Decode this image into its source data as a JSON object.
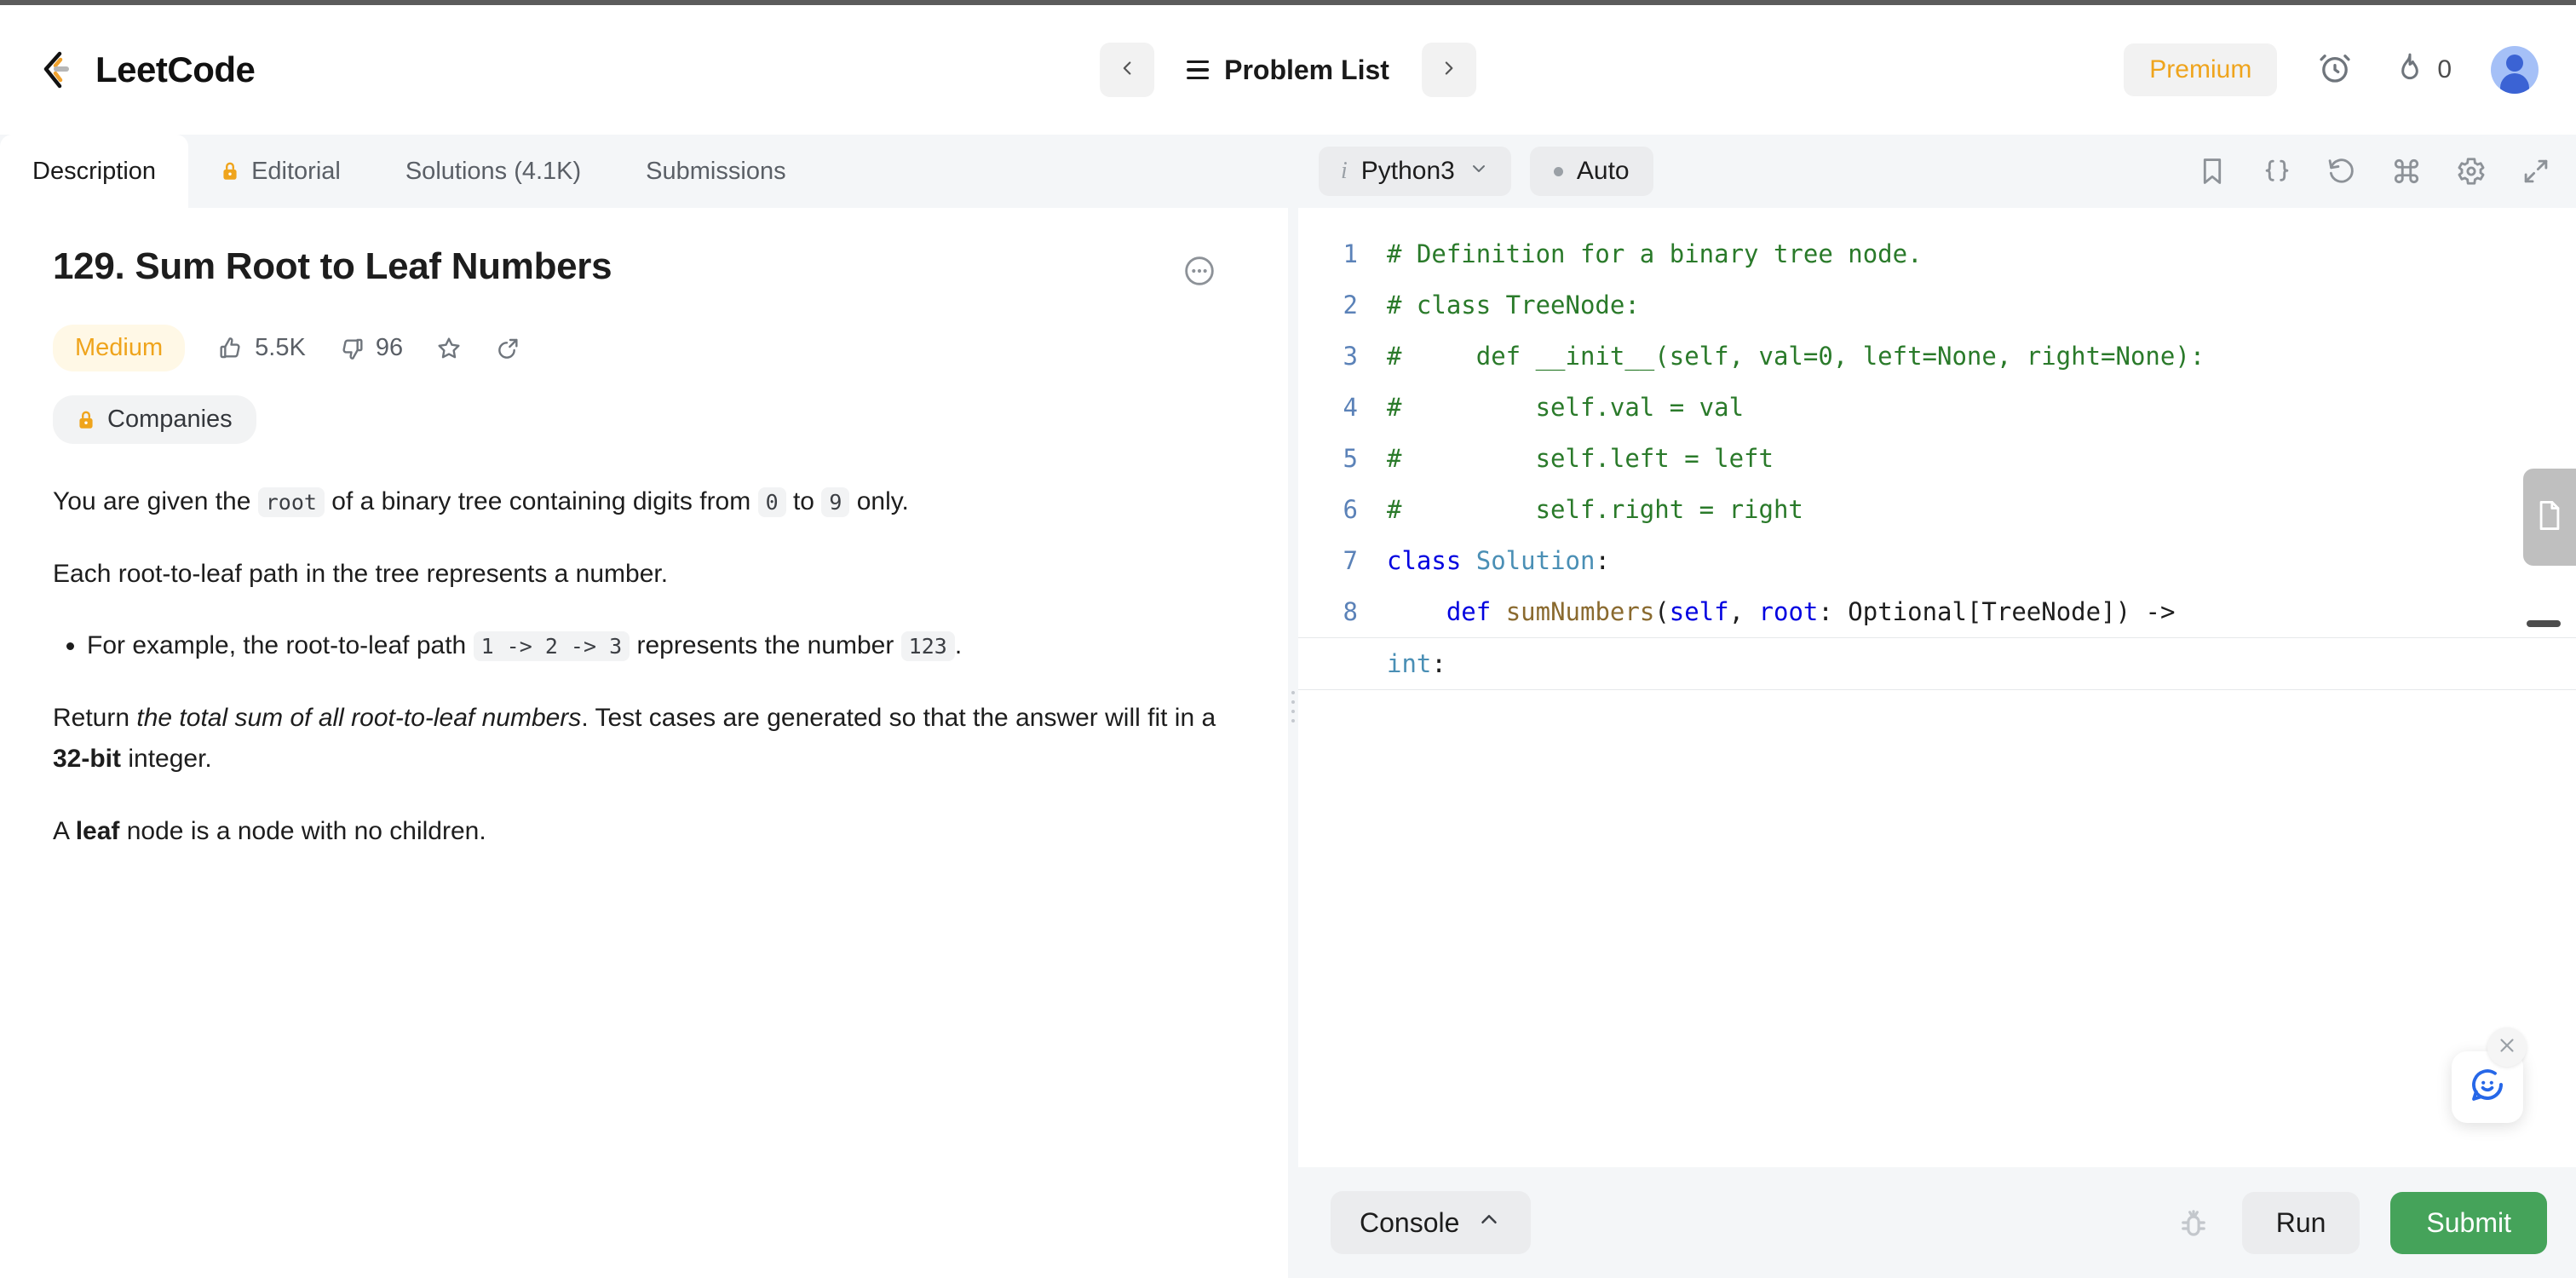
{
  "brand": {
    "name": "LeetCode",
    "logo_icon": "leetcode-logo-icon"
  },
  "header": {
    "prev_icon": "chevron-left-icon",
    "next_icon": "chevron-right-icon",
    "menu_icon": "hamburger-menu-icon",
    "problem_list_label": "Problem List",
    "premium_label": "Premium",
    "timer_icon": "alarm-clock-icon",
    "streak_icon": "flame-icon",
    "streak_count": "0",
    "avatar_icon": "user-avatar-icon"
  },
  "left_panel": {
    "tabs": [
      {
        "label": "Description",
        "active": true,
        "icon": null
      },
      {
        "label": "Editorial",
        "active": false,
        "icon": "lock-icon"
      },
      {
        "label": "Solutions (4.1K)",
        "active": false,
        "icon": null
      },
      {
        "label": "Submissions",
        "active": false,
        "icon": null
      }
    ],
    "problem": {
      "title": "129. Sum Root to Leaf Numbers",
      "more_icon": "more-options-icon",
      "difficulty": "Medium",
      "difficulty_color": "#efa41c",
      "likes": "5.5K",
      "likes_icon": "thumbs-up-icon",
      "dislikes": "96",
      "dislikes_icon": "thumbs-down-icon",
      "favorite_icon": "star-icon",
      "share_icon": "share-icon",
      "companies_label": "Companies",
      "companies_icon": "lock-icon"
    },
    "description": {
      "p1_a": "You are given the ",
      "p1_code1": "root",
      "p1_b": " of a binary tree containing digits from ",
      "p1_code2": "0",
      "p1_c": " to ",
      "p1_code3": "9",
      "p1_d": " only.",
      "p2": "Each root-to-leaf path in the tree represents a number.",
      "li1_a": "For example, the root-to-leaf path ",
      "li1_code1": "1 -> 2 -> 3",
      "li1_b": " represents the number ",
      "li1_code2": "123",
      "li1_c": ".",
      "p3_a": "Return ",
      "p3_em": "the total sum of all root-to-leaf numbers",
      "p3_b": ". Test cases are generated so that the answer will fit in a ",
      "p3_strong": "32-bit",
      "p3_c": " integer.",
      "p4_a": "A ",
      "p4_strong": "leaf",
      "p4_b": " node is a node with no children."
    }
  },
  "editor": {
    "language": "Python3",
    "language_info_icon": "info-icon",
    "language_chevron_icon": "chevron-down-icon",
    "auto_label": "Auto",
    "tools": [
      {
        "name": "bookmark-icon"
      },
      {
        "name": "code-format-icon"
      },
      {
        "name": "reset-icon"
      },
      {
        "name": "command-shortcut-icon"
      },
      {
        "name": "settings-gear-icon"
      },
      {
        "name": "expand-fullscreen-icon"
      }
    ],
    "doc_tab_icon": "document-icon",
    "code": [
      {
        "n": "1",
        "tokens": [
          {
            "t": "# Definition for a binary tree node.",
            "c": "c-comment"
          }
        ]
      },
      {
        "n": "2",
        "tokens": [
          {
            "t": "# class TreeNode:",
            "c": "c-comment"
          }
        ]
      },
      {
        "n": "3",
        "tokens": [
          {
            "t": "#     def __init__(self, val=0, left=None, right=None):",
            "c": "c-comment"
          }
        ]
      },
      {
        "n": "4",
        "tokens": [
          {
            "t": "#         self.val = val",
            "c": "c-comment"
          }
        ]
      },
      {
        "n": "5",
        "tokens": [
          {
            "t": "#         self.left = left",
            "c": "c-comment"
          }
        ]
      },
      {
        "n": "6",
        "tokens": [
          {
            "t": "#         self.right = right",
            "c": "c-comment"
          }
        ]
      },
      {
        "n": "7",
        "tokens": [
          {
            "t": "class ",
            "c": "c-kw"
          },
          {
            "t": "Solution",
            "c": "c-cls"
          },
          {
            "t": ":",
            "c": "c-plain"
          }
        ]
      },
      {
        "n": "8",
        "tokens": [
          {
            "t": "    ",
            "c": "c-plain"
          },
          {
            "t": "def ",
            "c": "c-kw"
          },
          {
            "t": "sumNumbers",
            "c": "c-fn"
          },
          {
            "t": "(",
            "c": "c-plain"
          },
          {
            "t": "self",
            "c": "c-kw"
          },
          {
            "t": ", ",
            "c": "c-plain"
          },
          {
            "t": "root",
            "c": "c-kw"
          },
          {
            "t": ": Optional[TreeNode]) ->",
            "c": "c-plain"
          }
        ]
      }
    ],
    "code_wrapped_tail": [
      {
        "t": "int",
        "c": "c-type"
      },
      {
        "t": ":",
        "c": "c-plain"
      }
    ]
  },
  "bottom": {
    "console_label": "Console",
    "console_chevron_icon": "chevron-up-icon",
    "debug_icon": "bug-icon",
    "run_label": "Run",
    "submit_label": "Submit",
    "submit_color": "#45a35a"
  },
  "chat": {
    "icon": "chat-smiley-icon",
    "close_icon": "close-icon"
  }
}
